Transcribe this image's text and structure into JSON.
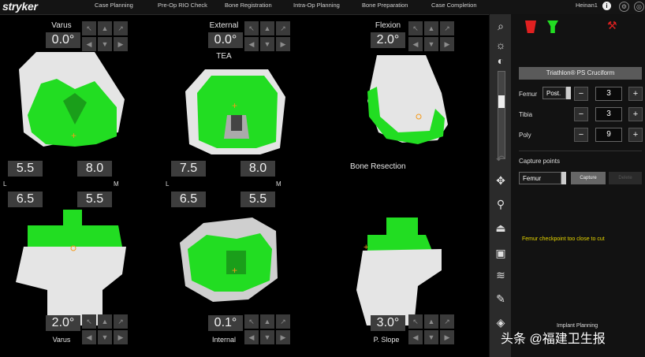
{
  "brand": "stryker",
  "nav": [
    "Case Planning",
    "Pre-Op RIO Check",
    "Bone Registration",
    "Intra-Op Planning",
    "Bone Preparation",
    "Case Completion"
  ],
  "user": "Heinan1",
  "top_icons": [
    "info-icon",
    "gear-icon"
  ],
  "views": {
    "femur_front": {
      "title": "Varus",
      "value": "0.0°"
    },
    "femur_axial": {
      "title": "External",
      "value": "0.0°",
      "sub": "TEA"
    },
    "femur_side": {
      "title": "Flexion",
      "value": "2.0°"
    },
    "tibia_front": {
      "value": "2.0°",
      "caption": "Varus"
    },
    "tibia_axial": {
      "value": "0.1°",
      "caption": "Internal"
    },
    "tibia_side": {
      "value": "3.0°",
      "caption": "P. Slope"
    }
  },
  "gaps": {
    "left_top_l": "5.5",
    "left_top_m": "8.0",
    "left_bot_l": "6.5",
    "left_bot_m": "5.5",
    "mid_top_l": "7.5",
    "mid_top_m": "8.0",
    "mid_bot_l": "6.5",
    "mid_bot_m": "5.5",
    "L": "L",
    "M": "M"
  },
  "bone_resection": "Bone Resection",
  "panel": {
    "implant_button": "Triathlon® PS Cruciform",
    "femur": {
      "label": "Femur",
      "select": "Post.",
      "value": "3"
    },
    "tibia": {
      "label": "Tibia",
      "value": "3"
    },
    "poly": {
      "label": "Poly",
      "value": "9"
    },
    "capture_title": "Capture points",
    "capture_select": "Femur",
    "capture_button": "Capture",
    "delete_button": "Delete",
    "warning": "Femur checkpoint too close to cut",
    "implant_planning": "Implant Planning"
  },
  "watermark": "头条 @福建卫生报",
  "colors": {
    "implant": "#22dd22",
    "bone": "#e8e8e8",
    "accent_red": "#e02020"
  }
}
